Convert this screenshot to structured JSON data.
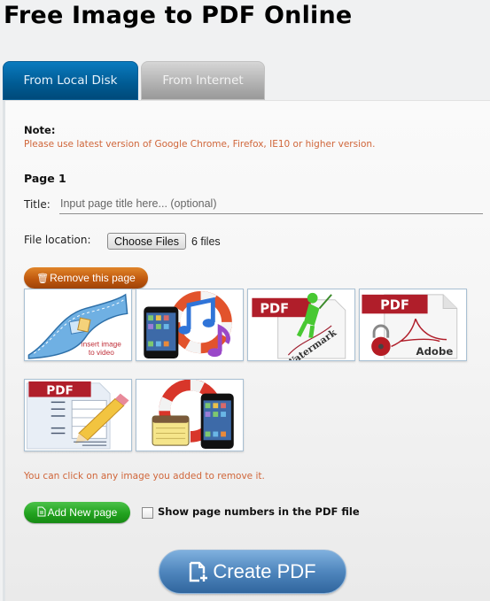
{
  "header": {
    "title": "Free Image to PDF Online"
  },
  "tabs": [
    {
      "label": "From Local Disk",
      "active": true
    },
    {
      "label": "From Internet",
      "active": false
    }
  ],
  "note": {
    "label": "Note:",
    "text": "Please use latest version of Google Chrome, Firefox, IE10 or higher version."
  },
  "page": {
    "heading": "Page 1",
    "title_label": "Title:",
    "title_value": "",
    "title_placeholder": "Input page title here... (optional)",
    "file_label": "File location:",
    "choose_files_label": "Choose Files",
    "file_count": "6 files",
    "remove_label": "Remove this page",
    "remove_icon": "trash-icon",
    "images": [
      {
        "name": "insert-image-to-video",
        "caption": "insert image to video",
        "caption_lines": [
          "insert image",
          "to video"
        ]
      },
      {
        "name": "iphone-music-recovery",
        "caption": ""
      },
      {
        "name": "pdf-watermark",
        "caption": "Watermark",
        "badge": "PDF"
      },
      {
        "name": "pdf-adobe-lock",
        "caption": "Adobe",
        "badge": "PDF"
      },
      {
        "name": "pdf-edit-pencil",
        "caption": "",
        "badge": "PDF"
      },
      {
        "name": "iphone-notes-recovery",
        "caption": ""
      }
    ]
  },
  "hint": "You can click on any image you added to remove it.",
  "actions": {
    "add_page_label": "Add New page",
    "add_page_icon": "document-icon",
    "page_numbers_label": "Show page numbers in the PDF file",
    "page_numbers_checked": false,
    "create_label": "Create PDF",
    "create_icon": "document-plus-icon"
  },
  "colors": {
    "tab_active": "#005a92",
    "tab_inactive": "#b0b0b0",
    "note_text": "#d0663a",
    "remove_button": "#c0590e",
    "add_button": "#22a21f",
    "create_button": "#4f86bd",
    "pdf_badge": "#b01e2a"
  }
}
